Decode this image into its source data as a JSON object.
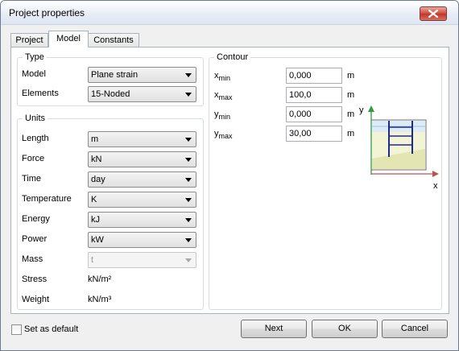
{
  "window": {
    "title": "Project properties"
  },
  "tabs": [
    {
      "label": "Project",
      "active": false
    },
    {
      "label": "Model",
      "active": true
    },
    {
      "label": "Constants",
      "active": false
    }
  ],
  "type_group": {
    "title": "Type",
    "model_label": "Model",
    "model_value": "Plane strain",
    "elements_label": "Elements",
    "elements_value": "15-Noded"
  },
  "units_group": {
    "title": "Units",
    "rows": [
      {
        "label": "Length",
        "value": "m",
        "disabled": false
      },
      {
        "label": "Force",
        "value": "kN",
        "disabled": false
      },
      {
        "label": "Time",
        "value": "day",
        "disabled": false
      },
      {
        "label": "Temperature",
        "value": "K",
        "disabled": false
      },
      {
        "label": "Energy",
        "value": "kJ",
        "disabled": false
      },
      {
        "label": "Power",
        "value": "kW",
        "disabled": false
      },
      {
        "label": "Mass",
        "value": "t",
        "disabled": true
      }
    ],
    "stress_label": "Stress",
    "stress_value": "kN/m²",
    "weight_label": "Weight",
    "weight_value": "kN/m³"
  },
  "contour_group": {
    "title": "Contour",
    "fields": [
      {
        "var": "x",
        "sub": "min",
        "value": "0,000",
        "unit": "m"
      },
      {
        "var": "x",
        "sub": "max",
        "value": "100,0",
        "unit": "m"
      },
      {
        "var": "y",
        "sub": "min",
        "value": "0,000",
        "unit": "m"
      },
      {
        "var": "y",
        "sub": "max",
        "value": "30,00",
        "unit": "m"
      }
    ],
    "diagram": {
      "y_axis_label": "y",
      "x_axis_label": "x"
    }
  },
  "footer": {
    "set_default_label": "Set as default",
    "set_default_checked": false,
    "next_label": "Next",
    "ok_label": "OK",
    "cancel_label": "Cancel"
  },
  "colors": {
    "axis": "#2e9c3f",
    "axis_arrow_x": "#c0504d",
    "soil": "#e6e8b6",
    "water": "#dcebf5",
    "structure": "#1f2b8c"
  }
}
